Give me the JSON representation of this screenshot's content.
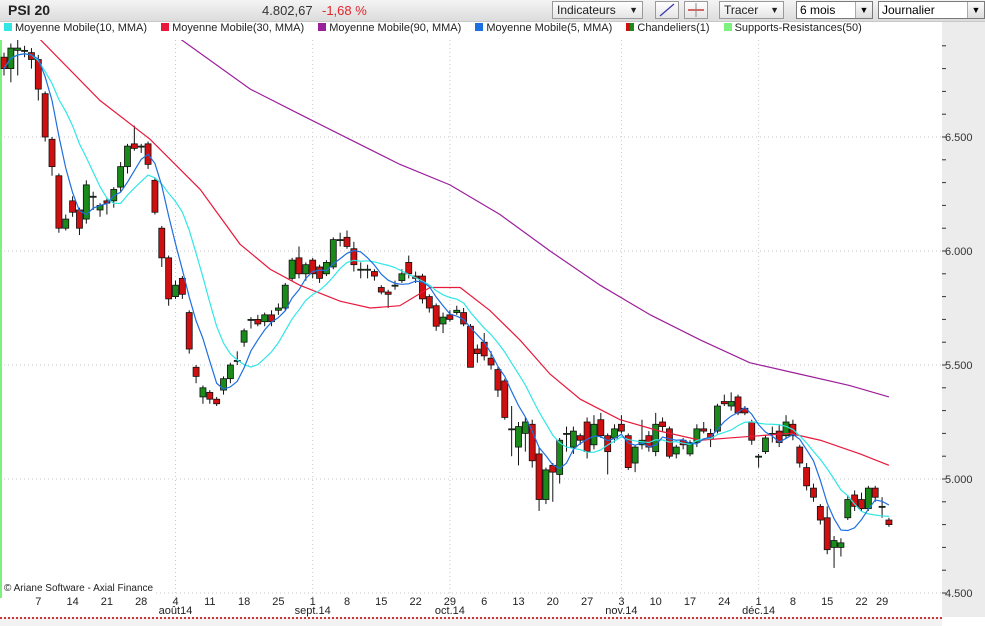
{
  "toolbar": {
    "title": "PSI 20",
    "last_value": "4.802,67",
    "change": "-1,68 %",
    "indicators_label": "Indicateurs",
    "draw_label": "Tracer",
    "period_value": "6 mois",
    "interval_value": "Journalier",
    "dropdown_arrow": "▼"
  },
  "legend": [
    {
      "label": "Moyenne Mobile(10, MMA)",
      "color": "#33e6e6"
    },
    {
      "label": "Moyenne Mobile(30, MMA)",
      "color": "#e8193c"
    },
    {
      "label": "Moyenne Mobile(90, MMA)",
      "color": "#9b1f9b"
    },
    {
      "label": "Moyenne Mobile(5, MMA)",
      "color": "#1e6fe0"
    },
    {
      "label": "Chandeliers(1)",
      "color": "#d01010"
    },
    {
      "label": "Supports-Resistances(50)",
      "color": "#7ef07e"
    }
  ],
  "copyright": "© Ariane Software - Axial Finance",
  "chart_data": {
    "type": "candlestick",
    "title": "PSI 20",
    "y_ticks": [
      "6.500",
      "6.000",
      "5.500",
      "5.000",
      "4.500"
    ],
    "y_tick_values": [
      6.5,
      6.0,
      5.5,
      5.0,
      4.5
    ],
    "ylim": [
      4.46,
      6.93
    ],
    "grid": true,
    "x_ticks": [
      {
        "label": "7",
        "index": 5
      },
      {
        "label": "14",
        "index": 10
      },
      {
        "label": "21",
        "index": 15
      },
      {
        "label": "28",
        "index": 20
      },
      {
        "label": "4",
        "index": 25
      },
      {
        "label": "11",
        "index": 30
      },
      {
        "label": "18",
        "index": 35
      },
      {
        "label": "25",
        "index": 40
      },
      {
        "label": "1",
        "index": 45
      },
      {
        "label": "8",
        "index": 50
      },
      {
        "label": "15",
        "index": 55
      },
      {
        "label": "22",
        "index": 60
      },
      {
        "label": "29",
        "index": 65
      },
      {
        "label": "6",
        "index": 70
      },
      {
        "label": "13",
        "index": 75
      },
      {
        "label": "20",
        "index": 80
      },
      {
        "label": "27",
        "index": 85
      },
      {
        "label": "3",
        "index": 90
      },
      {
        "label": "10",
        "index": 95
      },
      {
        "label": "17",
        "index": 100
      },
      {
        "label": "24",
        "index": 105
      },
      {
        "label": "1",
        "index": 110
      },
      {
        "label": "8",
        "index": 115
      },
      {
        "label": "15",
        "index": 120
      },
      {
        "label": "22",
        "index": 125
      },
      {
        "label": "29",
        "index": 128
      }
    ],
    "months": [
      {
        "label": "août14",
        "index": 25
      },
      {
        "label": "sept.14",
        "index": 45
      },
      {
        "label": "oct.14",
        "index": 65
      },
      {
        "label": "nov.14",
        "index": 90
      },
      {
        "label": "déc.14",
        "index": 110
      }
    ],
    "ohlc": [
      [
        6.85,
        6.87,
        6.77,
        6.8
      ],
      [
        6.8,
        6.91,
        6.74,
        6.89
      ],
      [
        6.88,
        6.93,
        6.77,
        6.89
      ],
      [
        6.88,
        6.9,
        6.85,
        6.88
      ],
      [
        6.87,
        6.89,
        6.8,
        6.84
      ],
      [
        6.84,
        6.86,
        6.66,
        6.71
      ],
      [
        6.69,
        6.7,
        6.48,
        6.5
      ],
      [
        6.49,
        6.5,
        6.33,
        6.37
      ],
      [
        6.33,
        6.34,
        6.08,
        6.1
      ],
      [
        6.1,
        6.16,
        6.09,
        6.14
      ],
      [
        6.22,
        6.24,
        6.15,
        6.17
      ],
      [
        6.18,
        6.19,
        6.07,
        6.1
      ],
      [
        6.14,
        6.31,
        6.12,
        6.29
      ],
      [
        6.24,
        6.26,
        6.18,
        6.24
      ],
      [
        6.18,
        6.21,
        6.15,
        6.2
      ],
      [
        6.22,
        6.23,
        6.16,
        6.21
      ],
      [
        6.22,
        6.28,
        6.19,
        6.27
      ],
      [
        6.28,
        6.39,
        6.26,
        6.37
      ],
      [
        6.37,
        6.47,
        6.34,
        6.46
      ],
      [
        6.47,
        6.55,
        6.44,
        6.45
      ],
      [
        6.46,
        6.47,
        6.43,
        6.46
      ],
      [
        6.47,
        6.48,
        6.36,
        6.38
      ],
      [
        6.31,
        6.32,
        6.16,
        6.17
      ],
      [
        6.1,
        6.11,
        5.93,
        5.97
      ],
      [
        5.97,
        5.98,
        5.76,
        5.79
      ],
      [
        5.8,
        5.87,
        5.79,
        5.85
      ],
      [
        5.88,
        5.89,
        5.79,
        5.81
      ],
      [
        5.73,
        5.74,
        5.55,
        5.57
      ],
      [
        5.49,
        5.5,
        5.42,
        5.45
      ],
      [
        5.36,
        5.41,
        5.33,
        5.4
      ],
      [
        5.38,
        5.39,
        5.33,
        5.35
      ],
      [
        5.35,
        5.36,
        5.32,
        5.33
      ],
      [
        5.39,
        5.45,
        5.37,
        5.44
      ],
      [
        5.44,
        5.51,
        5.42,
        5.5
      ],
      [
        5.52,
        5.56,
        5.5,
        5.52
      ],
      [
        5.6,
        5.66,
        5.58,
        5.65
      ],
      [
        5.7,
        5.71,
        5.66,
        5.7
      ],
      [
        5.7,
        5.72,
        5.67,
        5.68
      ],
      [
        5.69,
        5.73,
        5.67,
        5.72
      ],
      [
        5.72,
        5.74,
        5.67,
        5.69
      ],
      [
        5.74,
        5.77,
        5.72,
        5.75
      ],
      [
        5.75,
        5.86,
        5.74,
        5.85
      ],
      [
        5.88,
        5.97,
        5.87,
        5.96
      ],
      [
        5.97,
        6.02,
        5.88,
        5.9
      ],
      [
        5.9,
        5.95,
        5.87,
        5.94
      ],
      [
        5.96,
        5.97,
        5.88,
        5.9
      ],
      [
        5.93,
        5.94,
        5.86,
        5.88
      ],
      [
        5.9,
        5.96,
        5.89,
        5.95
      ],
      [
        5.93,
        6.06,
        5.92,
        6.05
      ],
      [
        6.05,
        6.08,
        6.02,
        6.05
      ],
      [
        6.06,
        6.09,
        6.01,
        6.02
      ],
      [
        6.01,
        6.04,
        5.91,
        5.94
      ],
      [
        5.92,
        5.95,
        5.88,
        5.92
      ],
      [
        5.92,
        5.94,
        5.88,
        5.92
      ],
      [
        5.91,
        5.92,
        5.87,
        5.89
      ],
      [
        5.84,
        5.85,
        5.81,
        5.82
      ],
      [
        5.82,
        5.83,
        5.75,
        5.81
      ],
      [
        5.85,
        5.87,
        5.83,
        5.85
      ],
      [
        5.87,
        5.92,
        5.86,
        5.9
      ],
      [
        5.95,
        5.98,
        5.88,
        5.9
      ],
      [
        5.89,
        5.91,
        5.86,
        5.88
      ],
      [
        5.89,
        5.9,
        5.77,
        5.79
      ],
      [
        5.8,
        5.81,
        5.73,
        5.75
      ],
      [
        5.76,
        5.77,
        5.65,
        5.67
      ],
      [
        5.68,
        5.73,
        5.64,
        5.71
      ],
      [
        5.72,
        5.74,
        5.69,
        5.7
      ],
      [
        5.73,
        5.76,
        5.72,
        5.74
      ],
      [
        5.73,
        5.75,
        5.67,
        5.68
      ],
      [
        5.67,
        5.68,
        5.49,
        5.49
      ],
      [
        5.57,
        5.59,
        5.51,
        5.55
      ],
      [
        5.6,
        5.64,
        5.52,
        5.54
      ],
      [
        5.53,
        5.56,
        5.48,
        5.5
      ],
      [
        5.48,
        5.49,
        5.36,
        5.39
      ],
      [
        5.43,
        5.44,
        5.26,
        5.27
      ],
      [
        5.22,
        5.32,
        5.1,
        5.22
      ],
      [
        5.14,
        5.25,
        5.06,
        5.23
      ],
      [
        5.2,
        5.27,
        5.12,
        5.25
      ],
      [
        5.24,
        5.26,
        5.05,
        5.08
      ],
      [
        5.11,
        5.14,
        4.86,
        4.91
      ],
      [
        4.91,
        5.05,
        4.89,
        5.04
      ],
      [
        5.06,
        5.07,
        4.9,
        5.03
      ],
      [
        5.02,
        5.18,
        4.98,
        5.17
      ],
      [
        5.2,
        5.23,
        5.12,
        5.2
      ],
      [
        5.14,
        5.23,
        5.11,
        5.21
      ],
      [
        5.19,
        5.2,
        5.15,
        5.17
      ],
      [
        5.25,
        5.27,
        5.09,
        5.12
      ],
      [
        5.15,
        5.28,
        5.13,
        5.24
      ],
      [
        5.26,
        5.29,
        5.18,
        5.19
      ],
      [
        5.19,
        5.2,
        5.02,
        5.12
      ],
      [
        5.18,
        5.24,
        5.16,
        5.22
      ],
      [
        5.24,
        5.28,
        5.2,
        5.21
      ],
      [
        5.19,
        5.2,
        5.04,
        5.05
      ],
      [
        5.07,
        5.15,
        5.03,
        5.14
      ],
      [
        5.15,
        5.26,
        5.13,
        5.17
      ],
      [
        5.19,
        5.21,
        5.12,
        5.14
      ],
      [
        5.12,
        5.29,
        5.1,
        5.24
      ],
      [
        5.25,
        5.27,
        5.21,
        5.23
      ],
      [
        5.22,
        5.23,
        5.09,
        5.1
      ],
      [
        5.11,
        5.15,
        5.09,
        5.14
      ],
      [
        5.17,
        5.18,
        5.13,
        5.15
      ],
      [
        5.11,
        5.17,
        5.1,
        5.16
      ],
      [
        5.16,
        5.24,
        5.14,
        5.22
      ],
      [
        5.22,
        5.25,
        5.2,
        5.21
      ],
      [
        5.2,
        5.22,
        5.14,
        5.18
      ],
      [
        5.21,
        5.33,
        5.2,
        5.32
      ],
      [
        5.34,
        5.37,
        5.32,
        5.33
      ],
      [
        5.32,
        5.38,
        5.3,
        5.34
      ],
      [
        5.36,
        5.37,
        5.28,
        5.29
      ],
      [
        5.31,
        5.32,
        5.28,
        5.29
      ],
      [
        5.25,
        5.26,
        5.15,
        5.17
      ],
      [
        5.1,
        5.11,
        5.05,
        5.1
      ],
      [
        5.12,
        5.19,
        5.11,
        5.18
      ],
      [
        5.2,
        5.23,
        5.16,
        5.2
      ],
      [
        5.21,
        5.24,
        5.14,
        5.16
      ],
      [
        5.19,
        5.28,
        5.18,
        5.25
      ],
      [
        5.24,
        5.26,
        5.17,
        5.19
      ],
      [
        5.14,
        5.15,
        5.05,
        5.07
      ],
      [
        5.05,
        5.07,
        4.95,
        4.97
      ],
      [
        4.96,
        4.98,
        4.9,
        4.92
      ],
      [
        4.88,
        4.89,
        4.8,
        4.82
      ],
      [
        4.83,
        4.88,
        4.67,
        4.69
      ],
      [
        4.7,
        4.75,
        4.61,
        4.73
      ],
      [
        4.7,
        4.74,
        4.66,
        4.72
      ],
      [
        4.83,
        4.93,
        4.82,
        4.91
      ],
      [
        4.93,
        4.95,
        4.86,
        4.88
      ],
      [
        4.91,
        4.94,
        4.86,
        4.87
      ],
      [
        4.87,
        4.97,
        4.86,
        4.96
      ],
      [
        4.96,
        4.97,
        4.9,
        4.92
      ],
      [
        4.88,
        4.92,
        4.83,
        4.88
      ],
      [
        4.82,
        4.83,
        4.79,
        4.8
      ]
    ],
    "ma30": [
      [
        5.2,
        6.93
      ],
      [
        14,
        6.66
      ],
      [
        21.3,
        6.49
      ],
      [
        28.6,
        6.27
      ],
      [
        34.4,
        6.03
      ],
      [
        38.8,
        5.92
      ],
      [
        43.1,
        5.85
      ],
      [
        49,
        5.78
      ],
      [
        53.4,
        5.75
      ],
      [
        57.7,
        5.76
      ],
      [
        62.1,
        5.84
      ],
      [
        66.5,
        5.84
      ],
      [
        70.8,
        5.74
      ],
      [
        75.2,
        5.61
      ],
      [
        79.6,
        5.46
      ],
      [
        84,
        5.35
      ],
      [
        89.8,
        5.26
      ],
      [
        95.6,
        5.21
      ],
      [
        101.5,
        5.17
      ],
      [
        105.8,
        5.18
      ],
      [
        110.2,
        5.19
      ],
      [
        114.6,
        5.2
      ],
      [
        119,
        5.17
      ],
      [
        124.8,
        5.11
      ],
      [
        129,
        5.06
      ]
    ],
    "ma90": [
      [
        25.7,
        6.93
      ],
      [
        35.9,
        6.71
      ],
      [
        43.1,
        6.6
      ],
      [
        50.4,
        6.49
      ],
      [
        57.7,
        6.38
      ],
      [
        65,
        6.29
      ],
      [
        72.3,
        6.16
      ],
      [
        79.6,
        6.0
      ],
      [
        86.9,
        5.85
      ],
      [
        94.2,
        5.72
      ],
      [
        101.5,
        5.61
      ],
      [
        108.7,
        5.51
      ],
      [
        116,
        5.46
      ],
      [
        123.3,
        5.41
      ],
      [
        129,
        5.36
      ]
    ]
  }
}
